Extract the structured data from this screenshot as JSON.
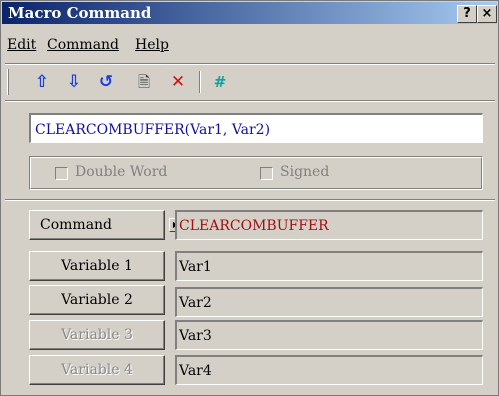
{
  "window": {
    "title": "Macro Command",
    "help_btn": "?",
    "close_btn": "×"
  },
  "menu": [
    {
      "label": "Edit"
    },
    {
      "label": "Command"
    },
    {
      "label": "Help"
    }
  ],
  "toolbar": {
    "move_up": "⇧",
    "move_down": "⇩",
    "undo": "↺",
    "edit": "🗎",
    "delete": "✕",
    "number": "#"
  },
  "command_text": "CLEARCOMBUFFER(Var1, Var2)",
  "options": {
    "double_word": "Double Word",
    "signed": "Signed"
  },
  "rows": [
    {
      "label": "Command",
      "value": "CLEARCOMBUFFER"
    },
    {
      "label": "Variable 1",
      "value": "Var1"
    },
    {
      "label": "Variable 2",
      "value": "Var2"
    },
    {
      "label": "Variable 3",
      "value": "Var3"
    },
    {
      "label": "Variable 4",
      "value": "Var4"
    }
  ],
  "colors": {
    "title_start": "#0a246a",
    "title_end": "#a6caf0",
    "command_value": "#a01010",
    "command_text": "#1010a0",
    "up_arrow": "#1a3fd8",
    "delete_x": "#d01010",
    "hash": "#10a0a0"
  }
}
